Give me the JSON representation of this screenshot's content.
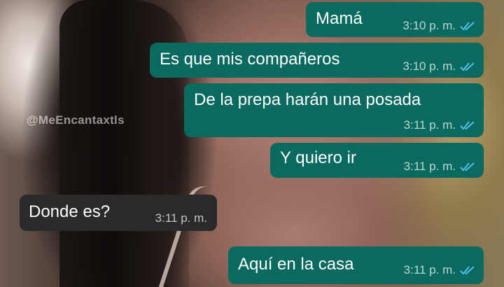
{
  "watermark": "@MeEncantaxtls",
  "colors": {
    "outgoing": "#0b6a5f",
    "incoming": "#2a2a2d",
    "read_ticks": "#53bdeb"
  },
  "messages": [
    {
      "text": "Mamá",
      "time": "3:10 p. m.",
      "direction": "outgoing",
      "status_icon": "double-check-icon"
    },
    {
      "text": "Es que mis compañeros",
      "time": "3:10 p. m.",
      "direction": "outgoing",
      "status_icon": "double-check-icon"
    },
    {
      "text": "De la prepa harán una posada",
      "time": "3:11 p. m.",
      "direction": "outgoing",
      "status_icon": "double-check-icon"
    },
    {
      "text": "Y quiero ir",
      "time": "3:11 p. m.",
      "direction": "outgoing",
      "status_icon": "double-check-icon"
    },
    {
      "text": "Donde es?",
      "time": "3:11 p. m.",
      "direction": "incoming"
    },
    {
      "text": "Aquí en la casa",
      "time": "3:11 p. m.",
      "direction": "outgoing",
      "status_icon": "double-check-icon"
    }
  ]
}
